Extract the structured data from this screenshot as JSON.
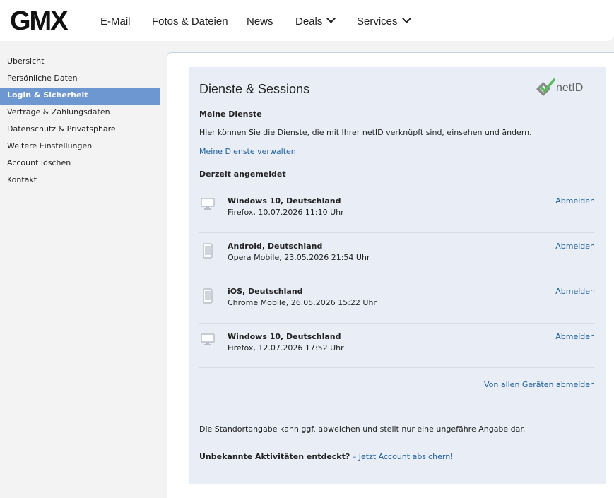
{
  "header": {
    "logo": "GMX",
    "nav": [
      {
        "label": "E-Mail"
      },
      {
        "label": "Fotos & Dateien"
      },
      {
        "label": "News"
      },
      {
        "label": "Deals"
      },
      {
        "label": "Services"
      }
    ]
  },
  "sidebar": {
    "items": [
      {
        "label": "Übersicht"
      },
      {
        "label": "Persönliche Daten"
      },
      {
        "label": "Login & Sicherheit",
        "active": true
      },
      {
        "label": "Verträge & Zahlungsdaten"
      },
      {
        "label": "Datenschutz & Privatsphäre"
      },
      {
        "label": "Weitere Einstellungen"
      },
      {
        "label": "Account löschen"
      },
      {
        "label": "Kontakt"
      }
    ]
  },
  "panel": {
    "title": "Dienste & Sessions",
    "netid_label": "netID",
    "services_heading": "Meine Dienste",
    "services_text": "Hier können Sie die Dienste, die mit Ihrer netID verknüpft sind, einsehen und ändern.",
    "services_link": "Meine Dienste verwalten",
    "sessions_heading": "Derzeit angemeldet",
    "sessions": [
      {
        "device": "desktop",
        "name": "Windows 10, Deutschland",
        "detail": "Firefox, 10.07.2026 11:10 Uhr",
        "action": "Abmelden"
      },
      {
        "device": "mobile",
        "name": "Android, Deutschland",
        "detail": "Opera Mobile, 23.05.2026 21:54 Uhr",
        "action": "Abmelden"
      },
      {
        "device": "mobile",
        "name": "iOS, Deutschland",
        "detail": "Chrome Mobile, 26.05.2026 15:22 Uhr",
        "action": "Abmelden"
      },
      {
        "device": "desktop",
        "name": "Windows 10, Deutschland",
        "detail": "Firefox, 12.07.2026 17:52 Uhr",
        "action": "Abmelden"
      }
    ],
    "logout_all": "Von allen Geräten abmelden",
    "location_note": "Die Standortangabe kann ggf. abweichen und stellt nur eine ungefähre Angabe dar.",
    "unknown_activity": "Unbekannte Aktivitäten entdeckt?",
    "dash": "–",
    "secure_link": "Jetzt Account absichern!"
  },
  "colors": {
    "active_sidebar": "#6d97d1",
    "panel_bg": "#e9eef6",
    "link": "#1d5f9c",
    "netid_check": "#5cb85c"
  }
}
